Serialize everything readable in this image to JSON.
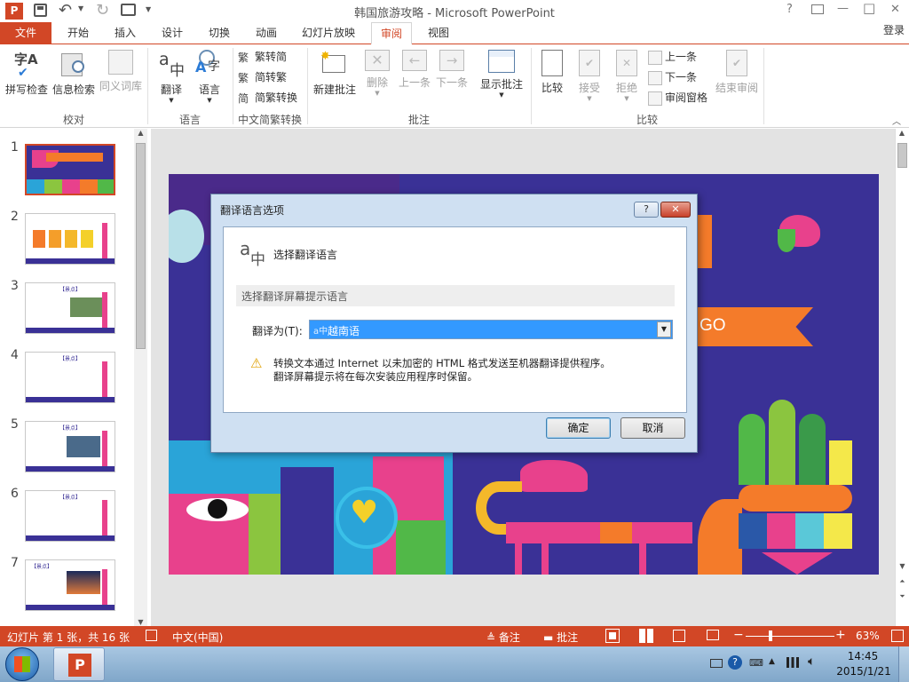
{
  "titlebar": {
    "title": "韩国旅游攻略 - Microsoft PowerPoint",
    "help": "?",
    "minimize": "—",
    "maximize": "□",
    "close": "✕"
  },
  "tabs": {
    "file": "文件",
    "items": [
      "开始",
      "插入",
      "设计",
      "切换",
      "动画",
      "幻灯片放映",
      "审阅",
      "视图"
    ],
    "active_index": 6,
    "login": "登录"
  },
  "ribbon": {
    "groups": {
      "proofing": {
        "label": "校对",
        "spell": "拼写检查",
        "research": "信息检索",
        "thesaurus": "同义词库"
      },
      "language": {
        "label": "语言",
        "translate": "翻译",
        "language": "语言"
      },
      "chinese": {
        "label": "中文简繁转换",
        "t2s": "繁转简",
        "s2t": "简转繁",
        "convert": "简繁转换"
      },
      "comments": {
        "label": "批注",
        "new": "新建批注",
        "delete": "删除",
        "prev": "上一条",
        "next": "下一条",
        "show": "显示批注"
      },
      "compare": {
        "label": "比较",
        "compare": "比较",
        "accept": "接受",
        "reject": "拒绝",
        "prev": "上一条",
        "next": "下一条",
        "pane": "审阅窗格",
        "end": "结束审阅"
      }
    }
  },
  "slides": {
    "numbers": [
      "1",
      "2",
      "3",
      "4",
      "5",
      "6",
      "7"
    ],
    "thumb_titles": [
      "【景点】",
      "【景点】",
      "【景点】",
      "【景点】",
      "【景点】"
    ]
  },
  "slide": {
    "go_text": "GO"
  },
  "dialog": {
    "title": "翻译语言选项",
    "help_btn": "?",
    "close_btn": "✕",
    "header": "选择翻译语言",
    "section": "选择翻译屏幕提示语言",
    "translate_to_label": "翻译为(T):",
    "selected_language": "越南语",
    "warning_line1": "转换文本通过 Internet 以未加密的 HTML 格式发送至机器翻译提供程序。",
    "warning_line2": "翻译屏幕提示将在每次安装应用程序时保留。",
    "ok": "确定",
    "cancel": "取消"
  },
  "statusbar": {
    "slide_info": "幻灯片 第 1 张，共 16 张",
    "language": "中文(中国)",
    "notes": "备注",
    "comments": "批注",
    "zoom": "63%"
  },
  "taskbar": {
    "time": "14:45",
    "date": "2015/1/21"
  },
  "colors": {
    "accent": "#d24726",
    "slide_bg": "#3a3196",
    "selection": "#3399ff"
  }
}
